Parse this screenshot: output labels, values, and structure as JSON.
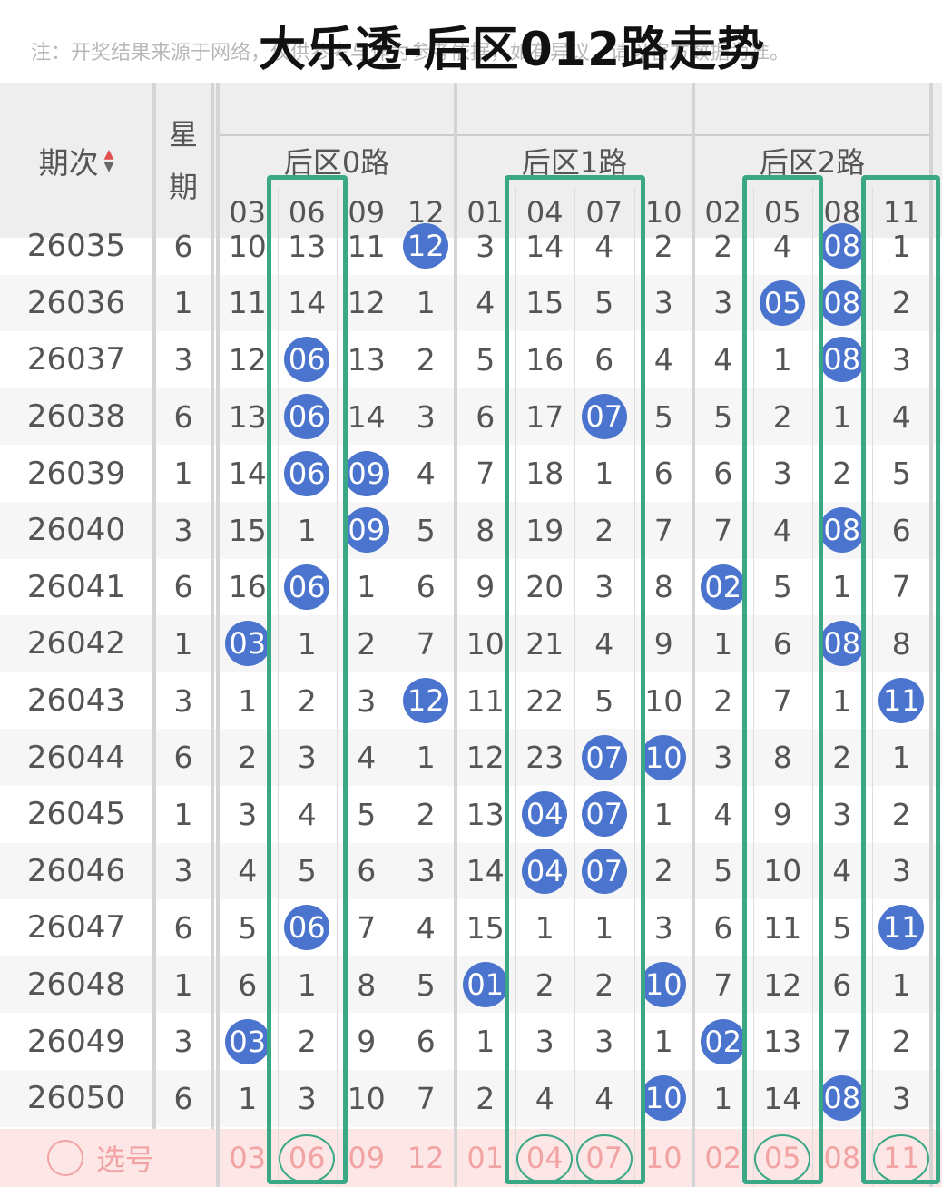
{
  "title": "大乐透-后区012路走势",
  "note": "注：开奖结果来源于网络，仅供参考与作为参考依据，如有异议，请以官方数据为准。",
  "header": {
    "issue_label": "期次",
    "week_label_1": "星",
    "week_label_2": "期",
    "groups": [
      "后区0路",
      "后区1路",
      "后区2路"
    ],
    "columns": [
      "03",
      "06",
      "09",
      "12",
      "01",
      "04",
      "07",
      "10",
      "02",
      "05",
      "08",
      "11"
    ]
  },
  "colors": {
    "ball": "#4a74cd",
    "highlight": "#3aa785",
    "select_row": "#fce6e6"
  },
  "rows": [
    {
      "issue": "26035",
      "week": "6",
      "cells": [
        "10",
        "13",
        "11",
        "12",
        "3",
        "14",
        "4",
        "2",
        "2",
        "4",
        "08",
        "1"
      ],
      "hits": [
        3,
        10
      ]
    },
    {
      "issue": "26036",
      "week": "1",
      "cells": [
        "11",
        "14",
        "12",
        "1",
        "4",
        "15",
        "5",
        "3",
        "3",
        "05",
        "08",
        "2"
      ],
      "hits": [
        9,
        10
      ]
    },
    {
      "issue": "26037",
      "week": "3",
      "cells": [
        "12",
        "06",
        "13",
        "2",
        "5",
        "16",
        "6",
        "4",
        "4",
        "1",
        "08",
        "3"
      ],
      "hits": [
        1,
        10
      ]
    },
    {
      "issue": "26038",
      "week": "6",
      "cells": [
        "13",
        "06",
        "14",
        "3",
        "6",
        "17",
        "07",
        "5",
        "5",
        "2",
        "1",
        "4"
      ],
      "hits": [
        1,
        6
      ]
    },
    {
      "issue": "26039",
      "week": "1",
      "cells": [
        "14",
        "06",
        "09",
        "4",
        "7",
        "18",
        "1",
        "6",
        "6",
        "3",
        "2",
        "5"
      ],
      "hits": [
        1,
        2
      ]
    },
    {
      "issue": "26040",
      "week": "3",
      "cells": [
        "15",
        "1",
        "09",
        "5",
        "8",
        "19",
        "2",
        "7",
        "7",
        "4",
        "08",
        "6"
      ],
      "hits": [
        2,
        10
      ]
    },
    {
      "issue": "26041",
      "week": "6",
      "cells": [
        "16",
        "06",
        "1",
        "6",
        "9",
        "20",
        "3",
        "8",
        "02",
        "5",
        "1",
        "7"
      ],
      "hits": [
        1,
        8
      ]
    },
    {
      "issue": "26042",
      "week": "1",
      "cells": [
        "03",
        "1",
        "2",
        "7",
        "10",
        "21",
        "4",
        "9",
        "1",
        "6",
        "08",
        "8"
      ],
      "hits": [
        0,
        10
      ]
    },
    {
      "issue": "26043",
      "week": "3",
      "cells": [
        "1",
        "2",
        "3",
        "12",
        "11",
        "22",
        "5",
        "10",
        "2",
        "7",
        "1",
        "11"
      ],
      "hits": [
        3,
        11
      ]
    },
    {
      "issue": "26044",
      "week": "6",
      "cells": [
        "2",
        "3",
        "4",
        "1",
        "12",
        "23",
        "07",
        "10",
        "3",
        "8",
        "2",
        "1"
      ],
      "hits": [
        6,
        7
      ]
    },
    {
      "issue": "26045",
      "week": "1",
      "cells": [
        "3",
        "4",
        "5",
        "2",
        "13",
        "04",
        "07",
        "1",
        "4",
        "9",
        "3",
        "2"
      ],
      "hits": [
        5,
        6
      ]
    },
    {
      "issue": "26046",
      "week": "3",
      "cells": [
        "4",
        "5",
        "6",
        "3",
        "14",
        "04",
        "07",
        "2",
        "5",
        "10",
        "4",
        "3"
      ],
      "hits": [
        5,
        6
      ]
    },
    {
      "issue": "26047",
      "week": "6",
      "cells": [
        "5",
        "06",
        "7",
        "4",
        "15",
        "1",
        "1",
        "3",
        "6",
        "11",
        "5",
        "11"
      ],
      "hits": [
        1,
        11
      ]
    },
    {
      "issue": "26048",
      "week": "1",
      "cells": [
        "6",
        "1",
        "8",
        "5",
        "01",
        "2",
        "2",
        "10",
        "7",
        "12",
        "6",
        "1"
      ],
      "hits": [
        4,
        7
      ]
    },
    {
      "issue": "26049",
      "week": "3",
      "cells": [
        "03",
        "2",
        "9",
        "6",
        "1",
        "3",
        "3",
        "1",
        "02",
        "13",
        "7",
        "2"
      ],
      "hits": [
        0,
        8
      ]
    },
    {
      "issue": "26050",
      "week": "6",
      "cells": [
        "1",
        "3",
        "10",
        "7",
        "2",
        "4",
        "4",
        "10",
        "1",
        "14",
        "08",
        "3"
      ],
      "hits": [
        7,
        10
      ]
    }
  ],
  "select_row": {
    "label": "选号",
    "values": [
      "03",
      "06",
      "09",
      "12",
      "01",
      "04",
      "07",
      "10",
      "02",
      "05",
      "08",
      "11"
    ],
    "circled": [
      1,
      5,
      6,
      9,
      11
    ]
  },
  "highlight_columns": [
    "06",
    "04",
    "07",
    "05",
    "11"
  ]
}
